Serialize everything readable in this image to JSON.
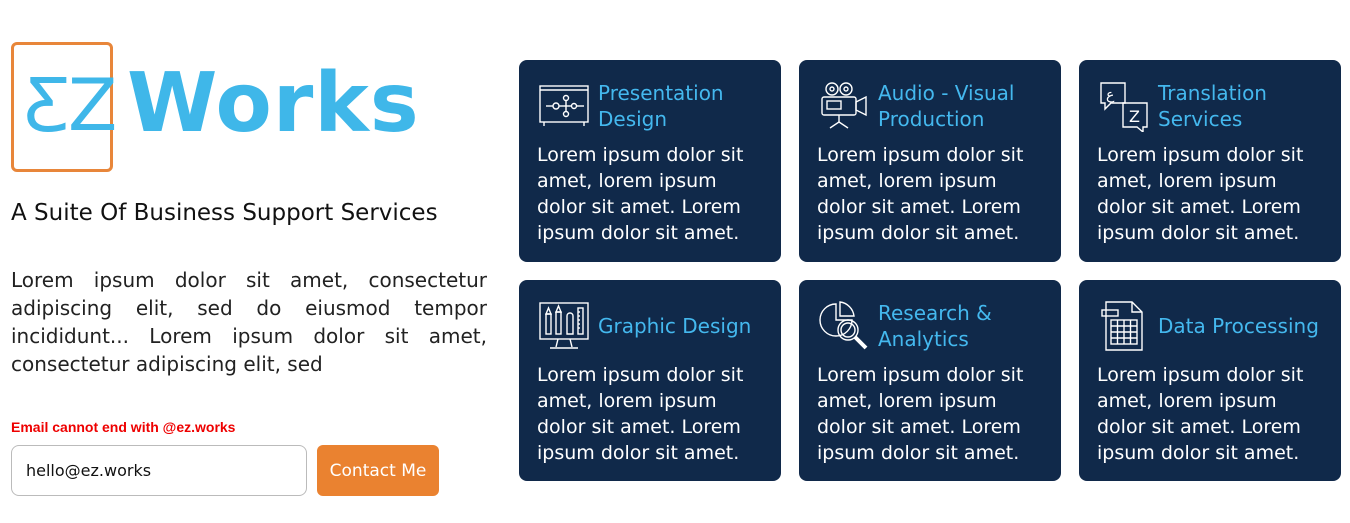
{
  "brand": {
    "logo_mark": "ƸZ",
    "logo_word": "Works",
    "tagline": "A Suite Of Business Support Services",
    "description": "Lorem ipsum dolor sit amet, consectetur adipiscing elit, sed do eiusmod tempor incididunt... Lorem ipsum dolor sit amet, consectetur adipiscing elit, sed"
  },
  "form": {
    "error": "Email cannot end with @ez.works",
    "email_value": "hello@ez.works",
    "button_label": "Contact Me"
  },
  "services": [
    {
      "title": "Presentation Design",
      "icon": "presentation-icon",
      "text": "Lorem ipsum dolor sit amet, lorem ipsum dolor sit amet. Lorem ipsum dolor sit amet."
    },
    {
      "title": "Audio - Visual Production",
      "icon": "video-camera-icon",
      "text": "Lorem ipsum dolor sit amet, lorem ipsum dolor sit amet. Lorem ipsum dolor sit amet."
    },
    {
      "title": "Translation Services",
      "icon": "translation-icon",
      "text": "Lorem ipsum dolor sit amet, lorem ipsum dolor sit amet. Lorem ipsum dolor sit amet."
    },
    {
      "title": "Graphic Design",
      "icon": "graphic-design-icon",
      "text": "Lorem ipsum dolor sit amet, lorem ipsum dolor sit amet. Lorem ipsum dolor sit amet."
    },
    {
      "title": "Research & Analytics",
      "icon": "research-icon",
      "text": "Lorem ipsum dolor sit amet, lorem ipsum dolor sit amet. Lorem ipsum dolor sit amet."
    },
    {
      "title": "Data Processing",
      "icon": "spreadsheet-icon",
      "text": "Lorem ipsum dolor sit amet, lorem ipsum dolor sit amet. Lorem ipsum dolor sit amet."
    }
  ],
  "colors": {
    "accent_blue": "#3fb7e9",
    "card_bg": "#10294a",
    "button_orange": "#ea8230",
    "error_red": "#e00000"
  }
}
